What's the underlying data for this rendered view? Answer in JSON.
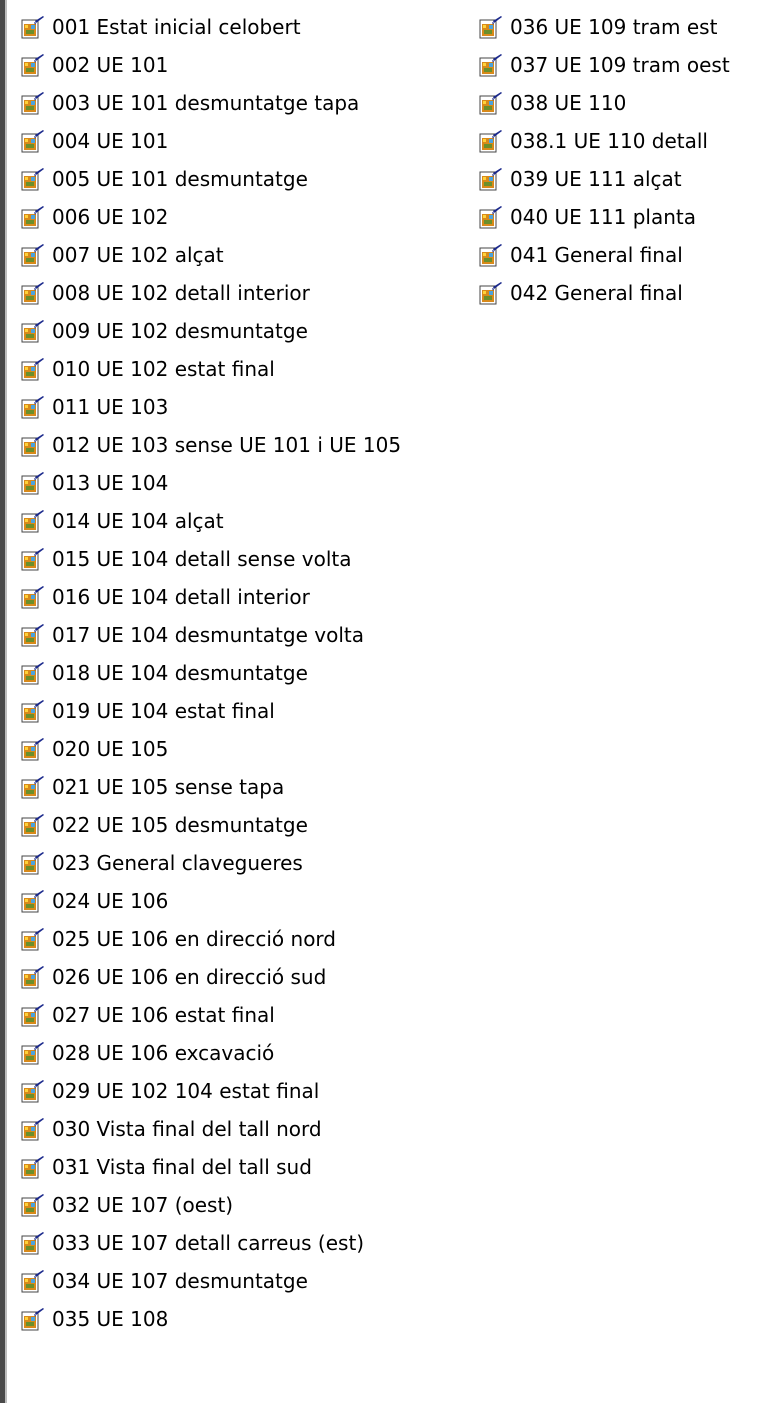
{
  "theme": {
    "background": "#ffffff",
    "text": "#000000",
    "icon_name": "image-file-icon"
  },
  "files": [
    {
      "label": "001 Estat inicial celobert"
    },
    {
      "label": "002 UE 101"
    },
    {
      "label": "003 UE 101 desmuntatge tapa"
    },
    {
      "label": "004 UE 101"
    },
    {
      "label": "005 UE 101 desmuntatge"
    },
    {
      "label": "006 UE 102"
    },
    {
      "label": "007 UE 102  alçat"
    },
    {
      "label": "008 UE 102 detall interior"
    },
    {
      "label": "009  UE 102 desmuntatge"
    },
    {
      "label": "010 UE 102 estat final"
    },
    {
      "label": "011 UE 103"
    },
    {
      "label": "012 UE 103 sense UE 101 i UE 105"
    },
    {
      "label": "013 UE 104"
    },
    {
      "label": "014 UE 104 alçat"
    },
    {
      "label": "015 UE 104 detall sense volta"
    },
    {
      "label": "016 UE 104 detall interior"
    },
    {
      "label": "017 UE 104 desmuntatge volta"
    },
    {
      "label": "018 UE 104 desmuntatge"
    },
    {
      "label": "019 UE 104 estat final"
    },
    {
      "label": "020 UE 105"
    },
    {
      "label": "021 UE 105 sense tapa"
    },
    {
      "label": "022 UE 105 desmuntatge"
    },
    {
      "label": "023 General clavegueres"
    },
    {
      "label": "024 UE 106"
    },
    {
      "label": "025 UE 106 en direcció nord"
    },
    {
      "label": "026 UE 106 en direcció sud"
    },
    {
      "label": "027 UE 106 estat final"
    },
    {
      "label": "028 UE 106 excavació"
    },
    {
      "label": "029 UE 102 104 estat final"
    },
    {
      "label": "030 Vista final del tall nord"
    },
    {
      "label": "031 Vista final del tall sud"
    },
    {
      "label": "032 UE 107 (oest)"
    },
    {
      "label": "033 UE 107 detall carreus (est)"
    },
    {
      "label": "034 UE 107 desmuntatge"
    },
    {
      "label": "035 UE 108"
    },
    {
      "label": "036 UE 109 tram est"
    },
    {
      "label": "037 UE 109 tram oest"
    },
    {
      "label": "038 UE 110"
    },
    {
      "label": "038.1 UE 110 detall"
    },
    {
      "label": "039 UE 111 alçat"
    },
    {
      "label": "040 UE 111 planta"
    },
    {
      "label": "041 General final"
    },
    {
      "label": "042 General final"
    }
  ]
}
